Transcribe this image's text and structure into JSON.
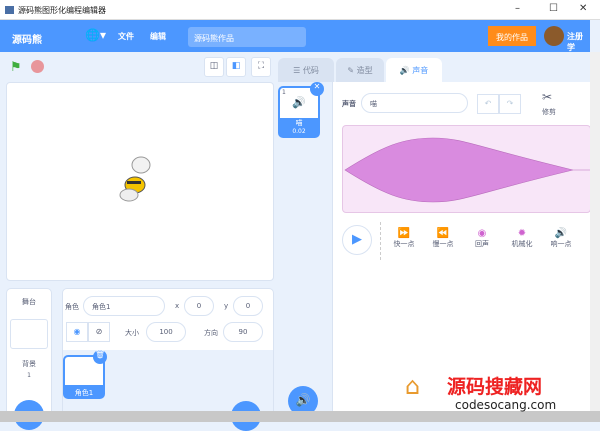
{
  "window": {
    "title": "源码熊图形化编程编辑器",
    "min": "–",
    "max": "☐",
    "close": "✕"
  },
  "menubar": {
    "logo": "源码熊",
    "language": "🌐▾",
    "file": "文件",
    "edit": "编辑",
    "project_title": "源码熊作品",
    "my_works": "我的作品",
    "register": "注册学"
  },
  "tabs": [
    {
      "label": "代码",
      "icon": "☰"
    },
    {
      "label": "造型",
      "icon": "✎"
    },
    {
      "label": "声音",
      "icon": "🔊"
    }
  ],
  "sound_list": [
    {
      "index": "1",
      "name": "喵",
      "duration": "0.02"
    }
  ],
  "sound_editor": {
    "name_label": "声音",
    "name_value": "喵",
    "undo": "↶",
    "redo": "↷",
    "trim_label": "修剪",
    "effects": [
      {
        "label": "快一点",
        "icon": "⏩"
      },
      {
        "label": "慢一点",
        "icon": "⏪"
      },
      {
        "label": "回声",
        "icon": "◉"
      },
      {
        "label": "机械化",
        "icon": "✹"
      },
      {
        "label": "响一点",
        "icon": "🔊"
      }
    ],
    "waveform_color": "#d98bdf"
  },
  "sprite_info": {
    "sprite_label": "角色",
    "sprite_name": "角色1",
    "x_label": "x",
    "x": "0",
    "y_label": "y",
    "y": "0",
    "size_label": "大小",
    "size": "100",
    "direction_label": "方向",
    "direction": "90"
  },
  "sprites": [
    {
      "name": "角色1"
    }
  ],
  "stage_panel": {
    "title": "舞台",
    "backdrop_label": "背景",
    "backdrop_count": "1"
  },
  "watermark": {
    "text": "源码搜藏网",
    "url": "codesocang.com"
  },
  "colors": {
    "accent": "#4c97ff",
    "orange": "#ff8c1a",
    "sound": "#cf63cf"
  }
}
